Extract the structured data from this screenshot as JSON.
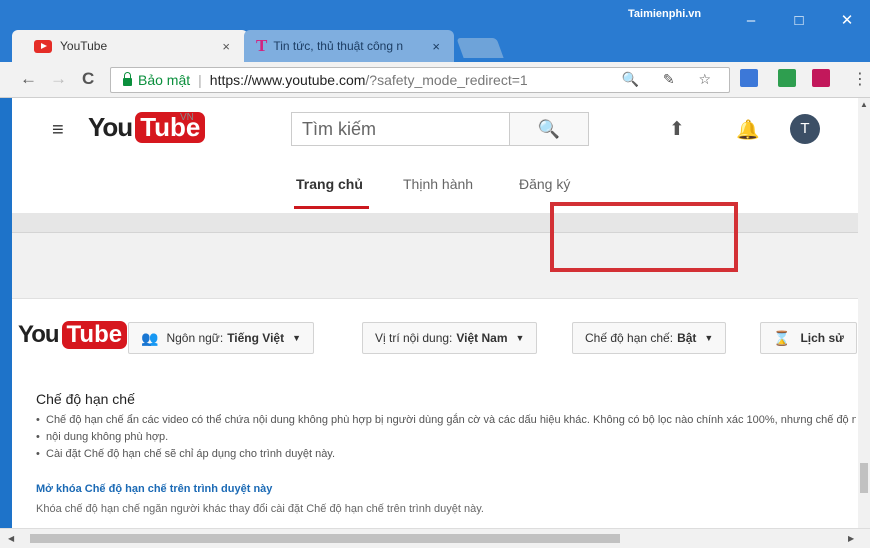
{
  "browser": {
    "tabs": [
      {
        "title": "YouTube",
        "close": "×"
      },
      {
        "title": "Tin tức, thủ thuật công n",
        "close": "×"
      }
    ],
    "brand": "Taimienphi.vn",
    "window": {
      "minimize": "–",
      "maximize": "□",
      "close": "✕"
    },
    "nav": {
      "back": "←",
      "forward": "→",
      "reload": "C"
    },
    "address": {
      "secure_label": "Bảo mật",
      "separator": "|",
      "url_host": "https://www.youtube.com",
      "url_path": "/?safety_mode_redirect=1"
    },
    "omni_icons": "🔍 ✎ ☆",
    "kebab": "⋮"
  },
  "header": {
    "menu_icon": "≡",
    "logo": {
      "you": "You",
      "tube": "Tube",
      "region": "VN"
    },
    "search_placeholder": "Tìm kiếm",
    "search_icon": "🔍",
    "upload_icon": "⬆",
    "bell_icon": "🔔",
    "avatar_letter": "T",
    "tabs": [
      "Trang chủ",
      "Thịnh hành",
      "Đăng ký"
    ]
  },
  "footer": {
    "logo": {
      "you": "You",
      "tube": "Tube"
    },
    "language": {
      "label": "Ngôn ngữ:",
      "value": "Tiếng Việt"
    },
    "location": {
      "label": "Vị trí nội dung:",
      "value": "Việt Nam"
    },
    "restricted": {
      "label": "Chế độ hạn chế:",
      "value": "Bật"
    },
    "history": "Lịch sử",
    "caret": "▼"
  },
  "restricted_panel": {
    "title": "Chế độ hạn chế",
    "bullets": [
      "Chế độ hạn chế ẩn các video có thể chứa nội dung không phù hợp bị người dùng gắn cờ và các dấu hiệu khác. Không có bộ lọc nào chính xác 100%, nhưng chế độ này sẽ giúp bạn tránh hầu hết",
      "nội dung không phù hợp.",
      "Cài đặt Chế độ hạn chế sẽ chỉ áp dụng cho trình duyệt này."
    ],
    "unlock_link": "Mở khóa Chế độ hạn chế trên trình duyệt này",
    "note": "Khóa chế độ hạn chế ngăn người khác thay đổi cài đặt Chế độ hạn chế trên trình duyệt này."
  },
  "colors": {
    "youtube_red": "#d6171e",
    "highlight": "#d33035",
    "secure_green": "#0a8f3c",
    "link_blue": "#1b6ab5"
  }
}
